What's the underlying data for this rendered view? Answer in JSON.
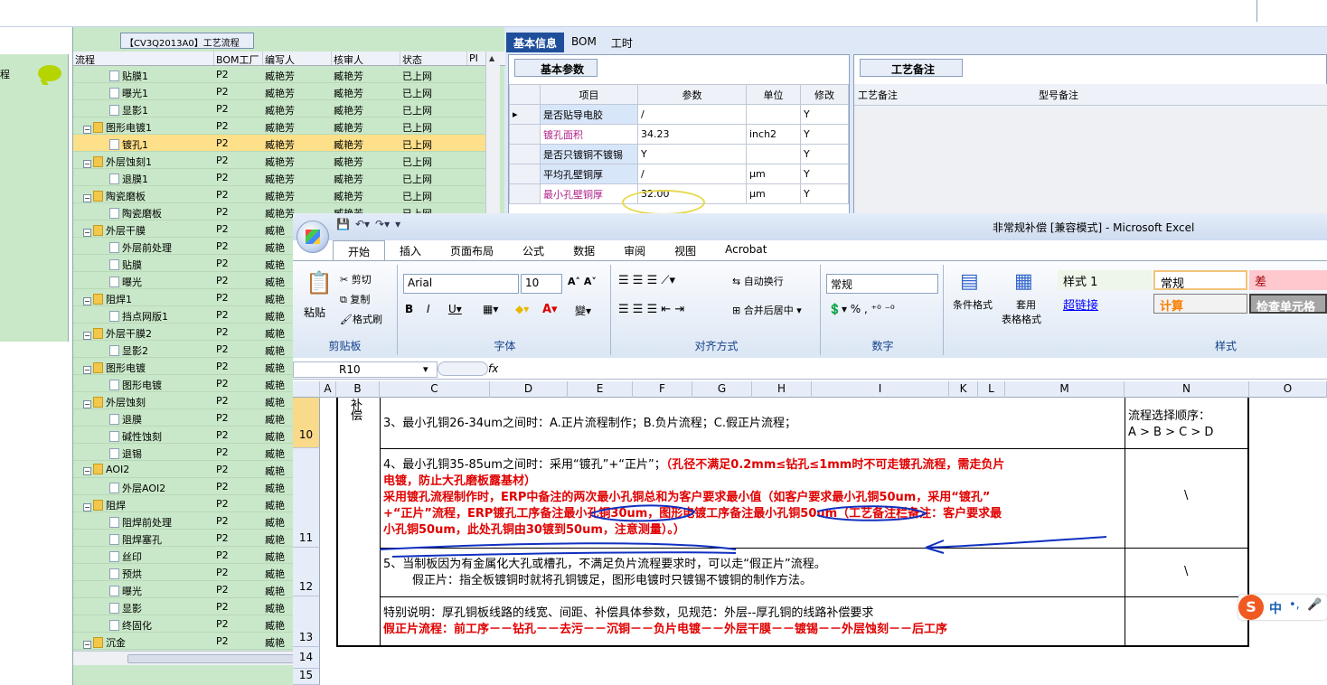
{
  "left_nav": {
    "label": "程"
  },
  "tree": {
    "tab_title": "【CV3Q2013A0】工艺流程",
    "headers": [
      "流程",
      "BOM工厂",
      "编写人",
      "核审人",
      "状态",
      "PI"
    ],
    "rows": [
      {
        "name": "贴膜1",
        "indent": 3,
        "type": "doc",
        "bom": "P2",
        "editor": "臧艳芳",
        "reviewer": "臧艳芳",
        "status": "已上网"
      },
      {
        "name": "曝光1",
        "indent": 3,
        "type": "doc",
        "bom": "P2",
        "editor": "臧艳芳",
        "reviewer": "臧艳芳",
        "status": "已上网"
      },
      {
        "name": "显影1",
        "indent": 3,
        "type": "doc",
        "bom": "P2",
        "editor": "臧艳芳",
        "reviewer": "臧艳芳",
        "status": "已上网"
      },
      {
        "name": "图形电镀1",
        "indent": 2,
        "type": "folder",
        "bom": "P2",
        "editor": "臧艳芳",
        "reviewer": "臧艳芳",
        "status": "已上网"
      },
      {
        "name": "镀孔1",
        "indent": 3,
        "type": "doc",
        "bom": "P2",
        "editor": "臧艳芳",
        "reviewer": "臧艳芳",
        "status": "已上网",
        "selected": true
      },
      {
        "name": "外层蚀刻1",
        "indent": 2,
        "type": "folder",
        "bom": "P2",
        "editor": "臧艳芳",
        "reviewer": "臧艳芳",
        "status": "已上网"
      },
      {
        "name": "退膜1",
        "indent": 3,
        "type": "doc",
        "bom": "P2",
        "editor": "臧艳芳",
        "reviewer": "臧艳芳",
        "status": "已上网"
      },
      {
        "name": "陶瓷磨板",
        "indent": 2,
        "type": "folder",
        "bom": "P2",
        "editor": "臧艳芳",
        "reviewer": "臧艳芳",
        "status": "已上网"
      },
      {
        "name": "陶瓷磨板",
        "indent": 3,
        "type": "doc",
        "bom": "P2",
        "editor": "臧艳芳",
        "reviewer": "臧艳芳",
        "status": "已上网"
      },
      {
        "name": "外层干膜",
        "indent": 2,
        "type": "folder",
        "bom": "P2",
        "editor": "臧艳",
        "reviewer": "",
        "status": ""
      },
      {
        "name": "外层前处理",
        "indent": 3,
        "type": "doc",
        "bom": "P2",
        "editor": "臧艳",
        "reviewer": "",
        "status": ""
      },
      {
        "name": "贴膜",
        "indent": 3,
        "type": "doc",
        "bom": "P2",
        "editor": "臧艳",
        "reviewer": "",
        "status": ""
      },
      {
        "name": "曝光",
        "indent": 3,
        "type": "doc",
        "bom": "P2",
        "editor": "臧艳",
        "reviewer": "",
        "status": ""
      },
      {
        "name": "阻焊1",
        "indent": 2,
        "type": "folder",
        "bom": "P2",
        "editor": "臧艳",
        "reviewer": "",
        "status": ""
      },
      {
        "name": "挡点网版1",
        "indent": 3,
        "type": "doc",
        "bom": "P2",
        "editor": "臧艳",
        "reviewer": "",
        "status": ""
      },
      {
        "name": "外层干膜2",
        "indent": 2,
        "type": "folder",
        "bom": "P2",
        "editor": "臧艳",
        "reviewer": "",
        "status": ""
      },
      {
        "name": "显影2",
        "indent": 3,
        "type": "doc",
        "bom": "P2",
        "editor": "臧艳",
        "reviewer": "",
        "status": ""
      },
      {
        "name": "图形电镀",
        "indent": 2,
        "type": "folder",
        "bom": "P2",
        "editor": "臧艳",
        "reviewer": "",
        "status": ""
      },
      {
        "name": "图形电镀",
        "indent": 3,
        "type": "doc",
        "bom": "P2",
        "editor": "臧艳",
        "reviewer": "",
        "status": ""
      },
      {
        "name": "外层蚀刻",
        "indent": 2,
        "type": "folder",
        "bom": "P2",
        "editor": "臧艳",
        "reviewer": "",
        "status": ""
      },
      {
        "name": "退膜",
        "indent": 3,
        "type": "doc",
        "bom": "P2",
        "editor": "臧艳",
        "reviewer": "",
        "status": ""
      },
      {
        "name": "碱性蚀刻",
        "indent": 3,
        "type": "doc",
        "bom": "P2",
        "editor": "臧艳",
        "reviewer": "",
        "status": ""
      },
      {
        "name": "退锡",
        "indent": 3,
        "type": "doc",
        "bom": "P2",
        "editor": "臧艳",
        "reviewer": "",
        "status": ""
      },
      {
        "name": "AOI2",
        "indent": 2,
        "type": "folder",
        "bom": "P2",
        "editor": "臧艳",
        "reviewer": "",
        "status": ""
      },
      {
        "name": "外层AOI2",
        "indent": 3,
        "type": "doc",
        "bom": "P2",
        "editor": "臧艳",
        "reviewer": "",
        "status": ""
      },
      {
        "name": "阻焊",
        "indent": 2,
        "type": "folder",
        "bom": "P2",
        "editor": "臧艳",
        "reviewer": "",
        "status": ""
      },
      {
        "name": "阻焊前处理",
        "indent": 3,
        "type": "doc",
        "bom": "P2",
        "editor": "臧艳",
        "reviewer": "",
        "status": ""
      },
      {
        "name": "阻焊塞孔",
        "indent": 3,
        "type": "doc",
        "bom": "P2",
        "editor": "臧艳",
        "reviewer": "",
        "status": ""
      },
      {
        "name": "丝印",
        "indent": 3,
        "type": "doc",
        "bom": "P2",
        "editor": "臧艳",
        "reviewer": "",
        "status": ""
      },
      {
        "name": "预烘",
        "indent": 3,
        "type": "doc",
        "bom": "P2",
        "editor": "臧艳",
        "reviewer": "",
        "status": ""
      },
      {
        "name": "曝光",
        "indent": 3,
        "type": "doc",
        "bom": "P2",
        "editor": "臧艳",
        "reviewer": "",
        "status": ""
      },
      {
        "name": "显影",
        "indent": 3,
        "type": "doc",
        "bom": "P2",
        "editor": "臧艳",
        "reviewer": "",
        "status": ""
      },
      {
        "name": "终固化",
        "indent": 3,
        "type": "doc",
        "bom": "P2",
        "editor": "臧艳",
        "reviewer": "",
        "status": ""
      },
      {
        "name": "沉金",
        "indent": 2,
        "type": "folder",
        "bom": "P2",
        "editor": "臧艳",
        "reviewer": "",
        "status": ""
      }
    ]
  },
  "right_tabs": [
    "基本信息",
    "BOM",
    "工时"
  ],
  "basic_params": {
    "tab": "基本参数",
    "headers": [
      "项目",
      "参数",
      "单位",
      "修改"
    ],
    "rows": [
      {
        "item": "是否贴导电胶",
        "value": "/",
        "unit": "",
        "mod": "Y",
        "pink": false,
        "current": true
      },
      {
        "item": "镀孔面积",
        "value": "34.23",
        "unit": "inch2",
        "mod": "Y",
        "pink": true
      },
      {
        "item": "是否只镀铜不镀锡",
        "value": "Y",
        "unit": "",
        "mod": "Y",
        "pink": false
      },
      {
        "item": "平均孔壁铜厚",
        "value": "/",
        "unit": "μm",
        "mod": "Y",
        "pink": false
      },
      {
        "item": "最小孔壁铜厚",
        "value": "32.00",
        "unit": "μm",
        "mod": "Y",
        "pink": true
      }
    ]
  },
  "process_notes": {
    "tab": "工艺备注",
    "col1": "工艺备注",
    "col2": "型号备注"
  },
  "excel": {
    "title": "非常规补偿  [兼容模式] - Microsoft Excel",
    "ribbon_tabs": [
      "开始",
      "插入",
      "页面布局",
      "公式",
      "数据",
      "审阅",
      "视图",
      "Acrobat"
    ],
    "clipboard": {
      "paste": "粘贴",
      "cut": "剪切",
      "copy": "复制",
      "format_painter": "格式刷",
      "label": "剪贴板"
    },
    "font": {
      "name": "Arial",
      "size": "10",
      "label": "字体"
    },
    "align": {
      "wrap": "自动换行",
      "merge": "合并后居中",
      "label": "对齐方式"
    },
    "number": {
      "format": "常规",
      "label": "数字"
    },
    "styles_group": {
      "cond": "条件格式",
      "table": "套用",
      "table2": "表格格式",
      "label": "样式"
    },
    "styles": {
      "s1": "样式 1",
      "normal": "常规",
      "bad": "差",
      "link": "超链接",
      "calc": "计算",
      "check": "检查单元格"
    },
    "name_box": "R10",
    "fx": "fx",
    "columns": [
      "A",
      "B",
      "C",
      "D",
      "E",
      "F",
      "G",
      "H",
      "I",
      "K",
      "L",
      "M",
      "N",
      "O"
    ],
    "rows": [
      {
        "num": "10",
        "b": "偿",
        "text": "3、最小孔铜26-34um之间时：A.正片流程制作；B.负片流程；C.假正片流程；",
        "n1": "流程选择顺序：",
        "n2": "A > B > C > D"
      },
      {
        "num": "11",
        "l1": "4、最小孔铜35-85um之间时：采用“镀孔”+“正片”；",
        "l1red": "（孔径不满足0.2mm≤钻孔≤1mm时不可走镀孔流程，需走负片",
        "l2": "电镀，防止大孔磨板露基材）",
        "l3": "采用镀孔流程制作时，ERP中备注的两次最小孔铜总和为客户要求最小值（如客户要求最小孔铜50um，采用“镀孔”",
        "l4": "+“正片”流程，ERP镀孔工序备注最小孔铜30um，图形电镀工序备注最小孔铜50um（工艺备注栏备注：客户要求最",
        "l5": "小孔铜50um，此处孔铜由30镀到50um，注意测量）。）",
        "n": "\\"
      },
      {
        "num": "12",
        "l1": "5、当制板因为有金属化大孔或槽孔，不满足负片流程要求时，可以走“假正片”流程。",
        "l2": "假正片：指全板镀铜时就将孔铜镀足，图形电镀时只镀锡不镀铜的制作方法。",
        "n": "\\"
      },
      {
        "num": "13",
        "l1": "特别说明：厚孔铜板线路的线宽、间距、补偿具体参数，见规范：外层--厚孔铜的线路补偿要求",
        "l2": "假正片流程：前工序－－钻孔－－去污－－沉铜－－负片电镀－－外层干膜－－镀锡－－外层蚀刻－－后工序"
      },
      {
        "num": "14"
      },
      {
        "num": "15"
      }
    ],
    "b_top": "补"
  },
  "ime": {
    "label": "中",
    "glyph": "S"
  }
}
